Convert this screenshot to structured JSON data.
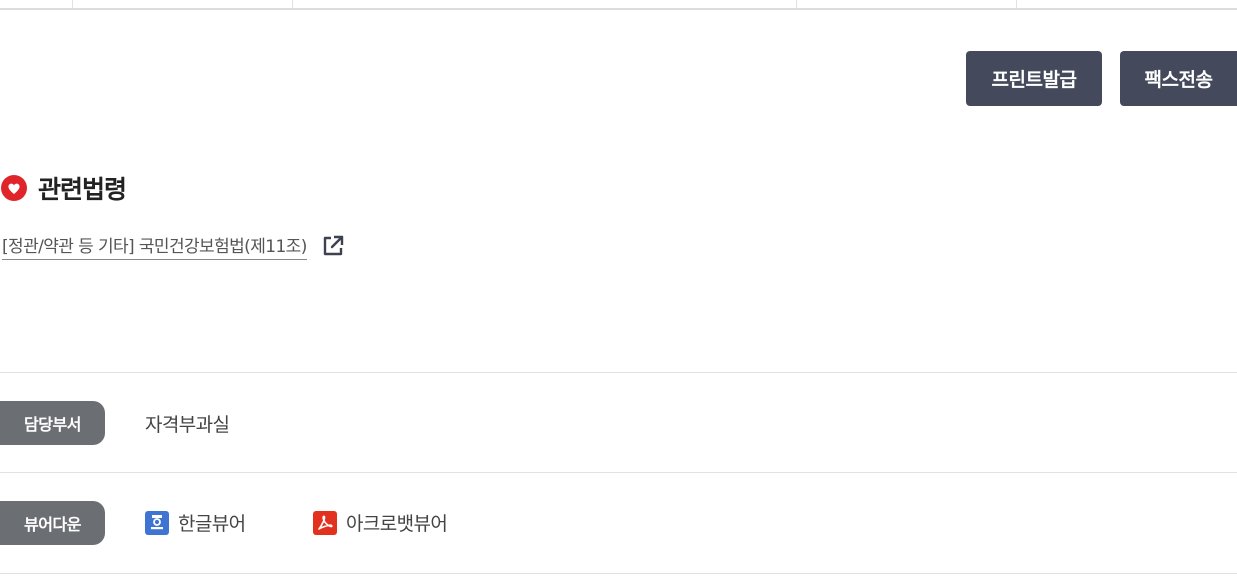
{
  "actions": {
    "print_label": "프린트발급",
    "fax_label": "팩스전송"
  },
  "related_law": {
    "heading": "관련법령",
    "link_text": "[정관/약관 등 기타] 국민건강보험법(제11조)"
  },
  "info": {
    "department": {
      "label": "담당부서",
      "value": "자격부과실"
    },
    "viewer": {
      "label": "뷰어다운",
      "items": [
        {
          "label": "한글뷰어",
          "icon": "hwp-viewer-icon",
          "color": "#3f74d3"
        },
        {
          "label": "아크로뱃뷰어",
          "icon": "acrobat-viewer-icon",
          "color": "#e2321f"
        }
      ]
    }
  },
  "colors": {
    "button_bg": "#444a5c",
    "pill_bg": "#6b6e73",
    "bullet_red": "#e0252a"
  }
}
